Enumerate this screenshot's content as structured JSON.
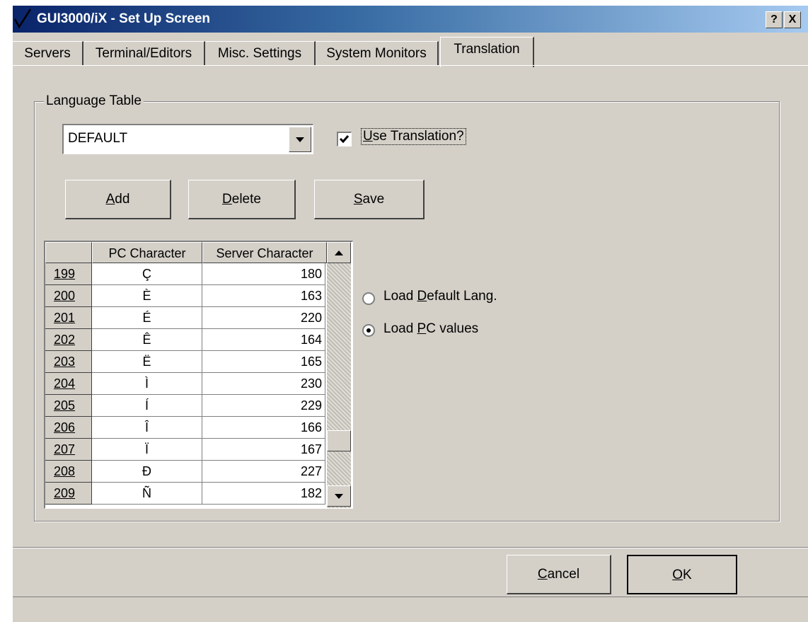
{
  "window": {
    "title": "GUI3000/iX - Set Up Screen",
    "help_label": "?",
    "close_label": "X"
  },
  "tabs": [
    {
      "label": "Servers"
    },
    {
      "label": "Terminal/Editors"
    },
    {
      "label": "Misc. Settings"
    },
    {
      "label": "System Monitors"
    },
    {
      "label": "Translation",
      "active": true
    }
  ],
  "language_table": {
    "group_label": "Language Table",
    "selected": "DEFAULT",
    "use_translation_checked": true
  },
  "buttons": {
    "add": "Add",
    "delete": "Delete",
    "save": "Save",
    "cancel": "Cancel",
    "ok": "OK"
  },
  "grid": {
    "headers": [
      "PC Character",
      "Server Character"
    ],
    "rows": [
      {
        "num": "199",
        "pc": "Ç",
        "server": "180"
      },
      {
        "num": "200",
        "pc": "È",
        "server": "163"
      },
      {
        "num": "201",
        "pc": "É",
        "server": "220"
      },
      {
        "num": "202",
        "pc": "Ê",
        "server": "164"
      },
      {
        "num": "203",
        "pc": "Ë",
        "server": "165"
      },
      {
        "num": "204",
        "pc": "Ì",
        "server": "230"
      },
      {
        "num": "205",
        "pc": "Í",
        "server": "229"
      },
      {
        "num": "206",
        "pc": "Î",
        "server": "166"
      },
      {
        "num": "207",
        "pc": "Ï",
        "server": "167"
      },
      {
        "num": "208",
        "pc": "Ð",
        "server": "227"
      },
      {
        "num": "209",
        "pc": "Ñ",
        "server": "182"
      }
    ]
  },
  "load_options": {
    "selected": "pc_values"
  }
}
